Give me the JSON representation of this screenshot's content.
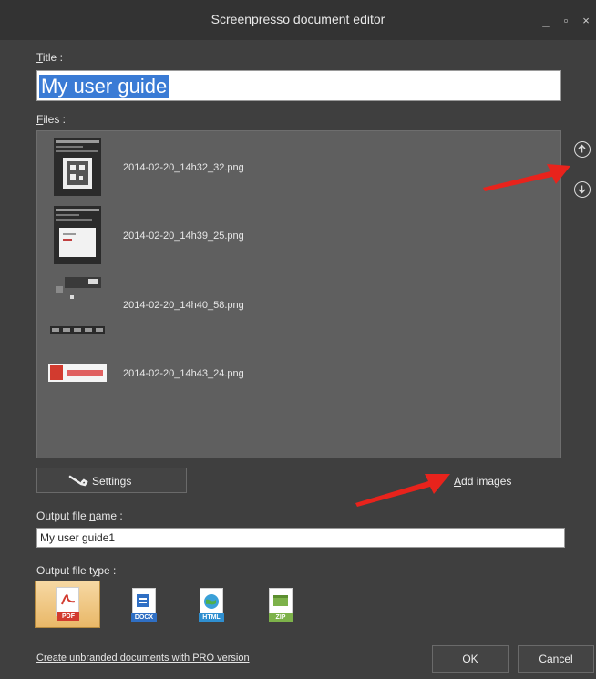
{
  "window": {
    "title": "Screenpresso document editor",
    "minimize_glyph": "_",
    "maximize_glyph": "▫",
    "close_glyph": "×"
  },
  "title_field": {
    "label_accesskey": "T",
    "label_rest": "itle :",
    "value": "My user guide"
  },
  "files_section": {
    "label_accesskey": "F",
    "label_rest": "iles :",
    "items": [
      {
        "name": "2014-02-20_14h32_32.png"
      },
      {
        "name": "2014-02-20_14h39_25.png"
      },
      {
        "name": "2014-02-20_14h40_58.png"
      },
      {
        "name": "2014-02-20_14h43_24.png"
      }
    ],
    "move_up_icon": "arrow-up-circle-icon",
    "move_down_icon": "arrow-down-circle-icon"
  },
  "settings_button": {
    "label": "Settings",
    "icon": "wrench-icon"
  },
  "add_images": {
    "accesskey": "A",
    "rest": "dd images"
  },
  "output_name": {
    "label_before": "Output file ",
    "label_accesskey": "n",
    "label_after": "ame :",
    "value": "My user guide1"
  },
  "output_type": {
    "label_before": "Output file t",
    "label_accesskey": "y",
    "label_after": "pe :",
    "types": [
      {
        "tag": "PDF",
        "selected": true,
        "color": "#d23b2f"
      },
      {
        "tag": "DOCX",
        "selected": false,
        "color": "#2f6fc4"
      },
      {
        "tag": "HTML",
        "selected": false,
        "color": "#2f8fd0"
      },
      {
        "tag": "ZIP",
        "selected": false,
        "color": "#7db24a"
      }
    ]
  },
  "pro_link": "Create unbranded documents with PRO version",
  "ok_button": {
    "accesskey": "O",
    "rest": "K"
  },
  "cancel_button": {
    "accesskey": "C",
    "rest": "ancel"
  },
  "colors": {
    "background": "#3f3f3f",
    "list_bg": "#5f5f5f",
    "selection": "#3a7bd5",
    "arrow": "#e8231c"
  }
}
